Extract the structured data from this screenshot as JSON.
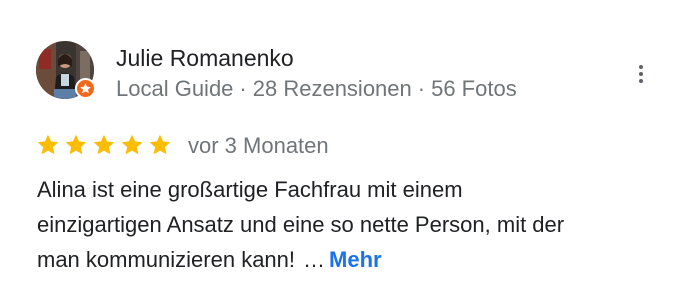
{
  "review": {
    "author": {
      "name": "Julie Romanenko",
      "guide_label": "Local Guide",
      "reviews": "28 Rezensionen",
      "photos": "56 Fotos",
      "separator": "·"
    },
    "rating": {
      "stars": 5,
      "max_stars": 5
    },
    "date": "vor 3 Monaten",
    "text_lines": [
      "Alina ist eine großartige Fachfrau mit einem",
      "einzigartigen Ansatz und eine so nette Person, mit der",
      "man kommunizieren kann!"
    ],
    "ellipsis": "…",
    "more_label": "Mehr"
  },
  "icons": {
    "more_menu": "more-vert-icon",
    "badge": "local-guide-star-icon",
    "star": "star-icon"
  },
  "colors": {
    "star": "#fbbc04",
    "badge": "#f06a1d",
    "link": "#1a73e8",
    "meta": "#70757a",
    "text": "#202124"
  }
}
